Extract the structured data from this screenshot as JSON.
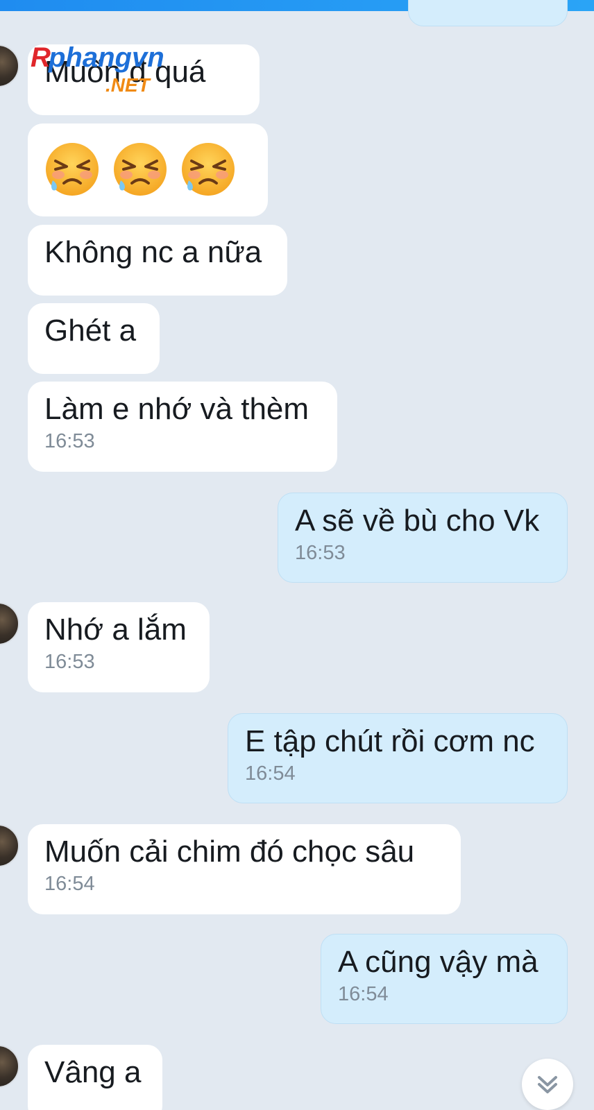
{
  "messages": [
    {
      "dir": "in",
      "text": "Muốn đ quá",
      "time": ""
    },
    {
      "dir": "in",
      "emoji": [
        "tearful-angry-face",
        "tearful-angry-face",
        "tearful-angry-face"
      ]
    },
    {
      "dir": "in",
      "text": "Không nc a nữa",
      "time": ""
    },
    {
      "dir": "in",
      "text": "Ghét a",
      "time": ""
    },
    {
      "dir": "in",
      "text": "Làm e nhớ và thèm",
      "time": "16:53"
    },
    {
      "dir": "out",
      "text": "A sẽ về bù cho Vk",
      "time": "16:53"
    },
    {
      "dir": "in",
      "text": "Nhớ a lắm",
      "time": "16:53"
    },
    {
      "dir": "out",
      "text": "E tập chút rồi cơm nc",
      "time": "16:54"
    },
    {
      "dir": "in",
      "text": "Muốn cải chim đó chọc sâu",
      "time": "16:54"
    },
    {
      "dir": "out",
      "text": "A cũng vậy mà",
      "time": "16:54"
    },
    {
      "dir": "in",
      "text": "Vâng a",
      "time": ""
    }
  ],
  "watermark": {
    "brand": "Rphangvn",
    "suffix": ".NET"
  },
  "colors": {
    "background": "#e2e9f1",
    "incoming_bubble": "#ffffff",
    "outgoing_bubble": "#d4edfc",
    "top_bar": "#1f8cf0",
    "timestamp": "#7f8b97"
  },
  "controls": {
    "scroll_down_icon": "double-chevron-down-icon"
  }
}
